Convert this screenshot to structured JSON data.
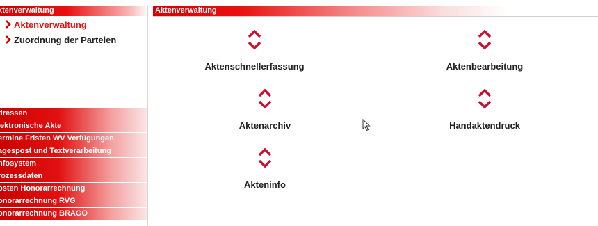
{
  "sidebar": {
    "header": "ktenverwaltung",
    "links": [
      {
        "label": "Aktenverwaltung",
        "active": true
      },
      {
        "label": "Zuordnung der Parteien",
        "active": false
      }
    ],
    "menu": [
      "dressen",
      "lektronische Akte",
      "ermine Fristen WV Verfügungen",
      "agespost und Textverarbeitung",
      "nfosystem",
      "rozessdaten",
      "osten Honorarrechnung",
      "onorarrechnung RVG",
      "onorarrechnung BRAGO"
    ]
  },
  "main": {
    "header": "Aktenverwaltung",
    "tiles": [
      {
        "label": "Aktenschnellerfassung",
        "icon": "chevron-arrows-icon"
      },
      {
        "label": "Aktenbearbeitung",
        "icon": "chevron-arrows-icon"
      },
      {
        "label": "Aktenarchiv",
        "icon": "chevron-arrows-icon"
      },
      {
        "label": "Handaktendruck",
        "icon": "chevron-arrows-icon"
      },
      {
        "label": "Akteninfo",
        "icon": "chevron-arrows-icon"
      }
    ]
  },
  "colors": {
    "accent": "#d40000",
    "chevron": "#c8102e",
    "text": "#222222"
  }
}
